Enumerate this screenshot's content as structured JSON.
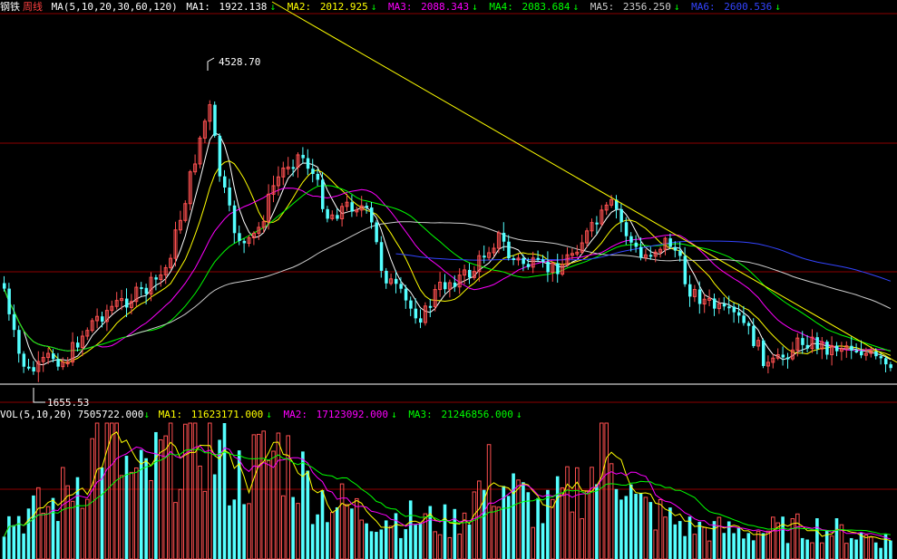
{
  "header": {
    "name": "钢铁",
    "period": "周线",
    "ma_label": "MA(5,10,20,30,60,120)",
    "items": [
      {
        "label": "MA1:",
        "value": "1922.138",
        "arrow": "↓",
        "color": "#ffffff"
      },
      {
        "label": "MA2:",
        "value": "2012.925",
        "arrow": "↓",
        "color": "#ffff00"
      },
      {
        "label": "MA3:",
        "value": "2088.343",
        "arrow": "↓",
        "color": "#ff00ff"
      },
      {
        "label": "MA4:",
        "value": "2083.684",
        "arrow": "↓",
        "color": "#00ff00"
      },
      {
        "label": "MA5:",
        "value": "2356.250",
        "arrow": "↓",
        "color": "#cccccc"
      },
      {
        "label": "MA6:",
        "value": "2600.536",
        "arrow": "↓",
        "color": "#3344ff"
      }
    ]
  },
  "volume_header": {
    "vol_label": "VOL(5,10,20)",
    "vol_value": "7505722.000",
    "vol_arrow": "↓",
    "items": [
      {
        "label": "MA1:",
        "value": "11623171.000",
        "arrow": "↓",
        "color": "#ffff00"
      },
      {
        "label": "MA2:",
        "value": "17123092.000",
        "arrow": "↓",
        "color": "#ff00ff"
      },
      {
        "label": "MA3:",
        "value": "21246856.000",
        "arrow": "↓",
        "color": "#00ff00"
      }
    ]
  },
  "annotations": {
    "high_label": "4528.70",
    "low_label": "1655.53"
  },
  "chart_data": {
    "type": "candlestick",
    "high": 4528.7,
    "low": 1655.53,
    "current_ma": {
      "MA1": 1922.138,
      "MA2": 2012.925,
      "MA3": 2088.343,
      "MA4": 2083.684,
      "MA5": 2356.25,
      "MA6": 2600.536
    },
    "volume_current": 7505722,
    "volume_ma": {
      "MA1": 11623171,
      "MA2": 17123092,
      "MA3": 21246856
    },
    "colors": {
      "up": "#ff5050",
      "down": "#54ffff",
      "grid": "#8b0000",
      "trendline": "#ffff00",
      "background": "#000000"
    }
  }
}
